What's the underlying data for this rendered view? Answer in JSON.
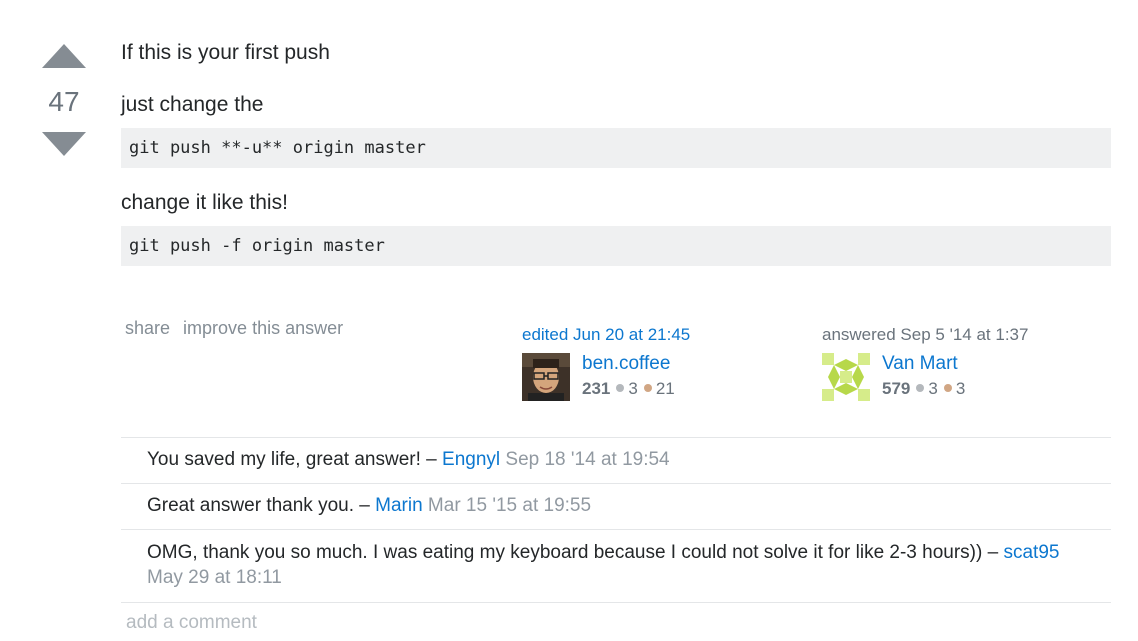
{
  "vote": {
    "count": "47"
  },
  "post": {
    "paragraph1": "If this is your first push",
    "paragraph2": "just change the",
    "code1": "git push **-u** origin master",
    "paragraph3": "change it like this!",
    "code2": "git push -f origin master"
  },
  "post_menu": {
    "share": "share",
    "improve": "improve this answer"
  },
  "edited_signature": {
    "action": "edited Jun 20 at 21:45",
    "user": "ben.coffee",
    "reputation": "231",
    "silver_badges": "3",
    "bronze_badges": "21"
  },
  "answered_signature": {
    "action": "answered Sep 5 '14 at 1:37",
    "user": "Van Mart",
    "reputation": "579",
    "silver_badges": "3",
    "bronze_badges": "3"
  },
  "comments": [
    {
      "text": "You saved my life, great answer! – ",
      "user": "Engnyl",
      "date": "Sep 18 '14 at 19:54"
    },
    {
      "text": "Great answer thank you. – ",
      "user": "Marin",
      "date": "Mar 15 '15 at 19:55"
    },
    {
      "text": "OMG, thank you so much. I was eating my keyboard because I could not solve it for like 2-3 hours)) – ",
      "user": "scat95",
      "date": "May 29 at 18:11"
    }
  ],
  "add_comment": "add a comment",
  "colors": {
    "link": "#0c77cf",
    "vote_arrow": "#858c93",
    "code_bg": "#eff0f1"
  },
  "icons": [
    "upvote-arrow-icon",
    "downvote-arrow-icon",
    "silver-badge-icon",
    "bronze-badge-icon"
  ]
}
